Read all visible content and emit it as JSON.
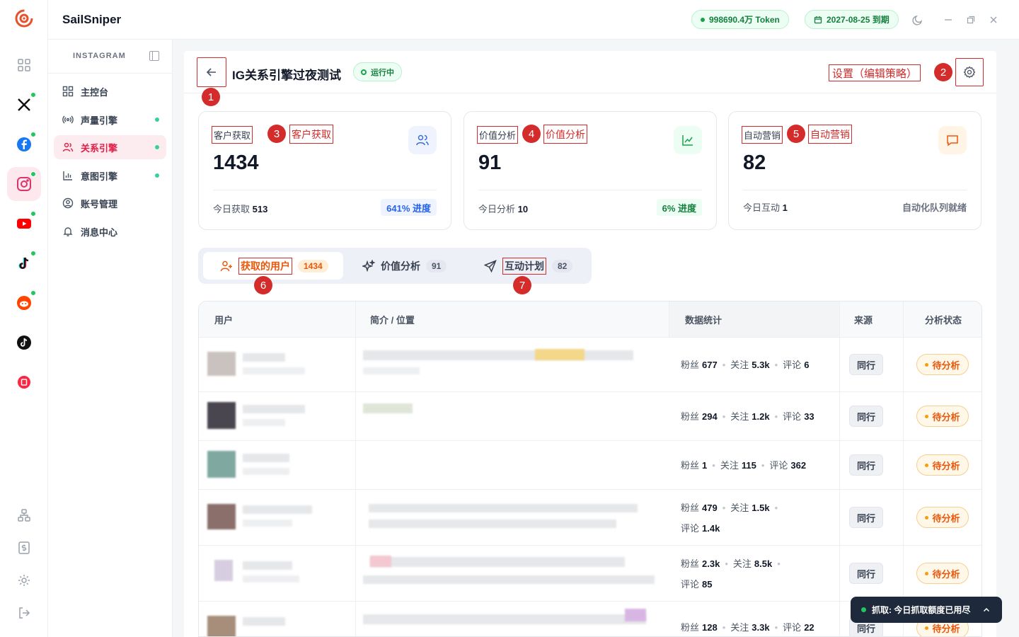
{
  "app": {
    "name": "SailSniper"
  },
  "topbar": {
    "token": "998690.4万 Token",
    "expiry": "2027-08-25 到期"
  },
  "sidebar": {
    "platform": "INSTAGRAM",
    "items": [
      {
        "label": "主控台"
      },
      {
        "label": "声量引擎"
      },
      {
        "label": "关系引擎"
      },
      {
        "label": "意图引擎"
      },
      {
        "label": "账号管理"
      },
      {
        "label": "消息中心"
      }
    ]
  },
  "page": {
    "title": "IG关系引擎过夜测试",
    "status": "运行中",
    "settings_label": "设置（编辑策略）"
  },
  "annotations": [
    "1",
    "2",
    "3",
    "4",
    "5",
    "6",
    "7"
  ],
  "stats": [
    {
      "title": "客户获取",
      "tag": "客户获取",
      "value": "1434",
      "sub_label": "今日获取",
      "sub_value": "513",
      "progress": "641% 进度"
    },
    {
      "title": "价值分析",
      "tag": "价值分析",
      "value": "91",
      "sub_label": "今日分析",
      "sub_value": "10",
      "progress": "6% 进度"
    },
    {
      "title": "自动营销",
      "tag": "自动营销",
      "value": "82",
      "sub_label": "今日互动",
      "sub_value": "1",
      "progress": "自动化队列就绪"
    }
  ],
  "tabs": [
    {
      "label": "获取的用户",
      "count": "1434"
    },
    {
      "label": "价值分析",
      "count": "91"
    },
    {
      "label": "互动计划",
      "count": "82"
    }
  ],
  "table": {
    "headers": [
      "用户",
      "简介 / 位置",
      "数据统计",
      "来源",
      "分析状态"
    ],
    "stat_labels": {
      "fans": "粉丝",
      "following": "关注",
      "comments": "评论"
    },
    "rows": [
      {
        "fans": "677",
        "following": "5.3k",
        "comments": "6",
        "source": "同行",
        "status": "待分析"
      },
      {
        "fans": "294",
        "following": "1.2k",
        "comments": "33",
        "source": "同行",
        "status": "待分析"
      },
      {
        "fans": "1",
        "following": "115",
        "comments": "362",
        "source": "同行",
        "status": "待分析"
      },
      {
        "fans": "479",
        "following": "1.5k",
        "comments": "1.4k",
        "source": "同行",
        "status": "待分析"
      },
      {
        "fans": "2.3k",
        "following": "8.5k",
        "comments": "85",
        "source": "同行",
        "status": "待分析"
      },
      {
        "fans": "128",
        "following": "3.3k",
        "comments": "22",
        "source": "同行",
        "status": "待分析"
      }
    ]
  },
  "toast": {
    "text": "抓取: 今日抓取额度已用尽"
  },
  "colors": {
    "accent": "#e11d48",
    "success": "#15803d",
    "warning": "#ea580c",
    "annotation": "#d42b2b"
  }
}
